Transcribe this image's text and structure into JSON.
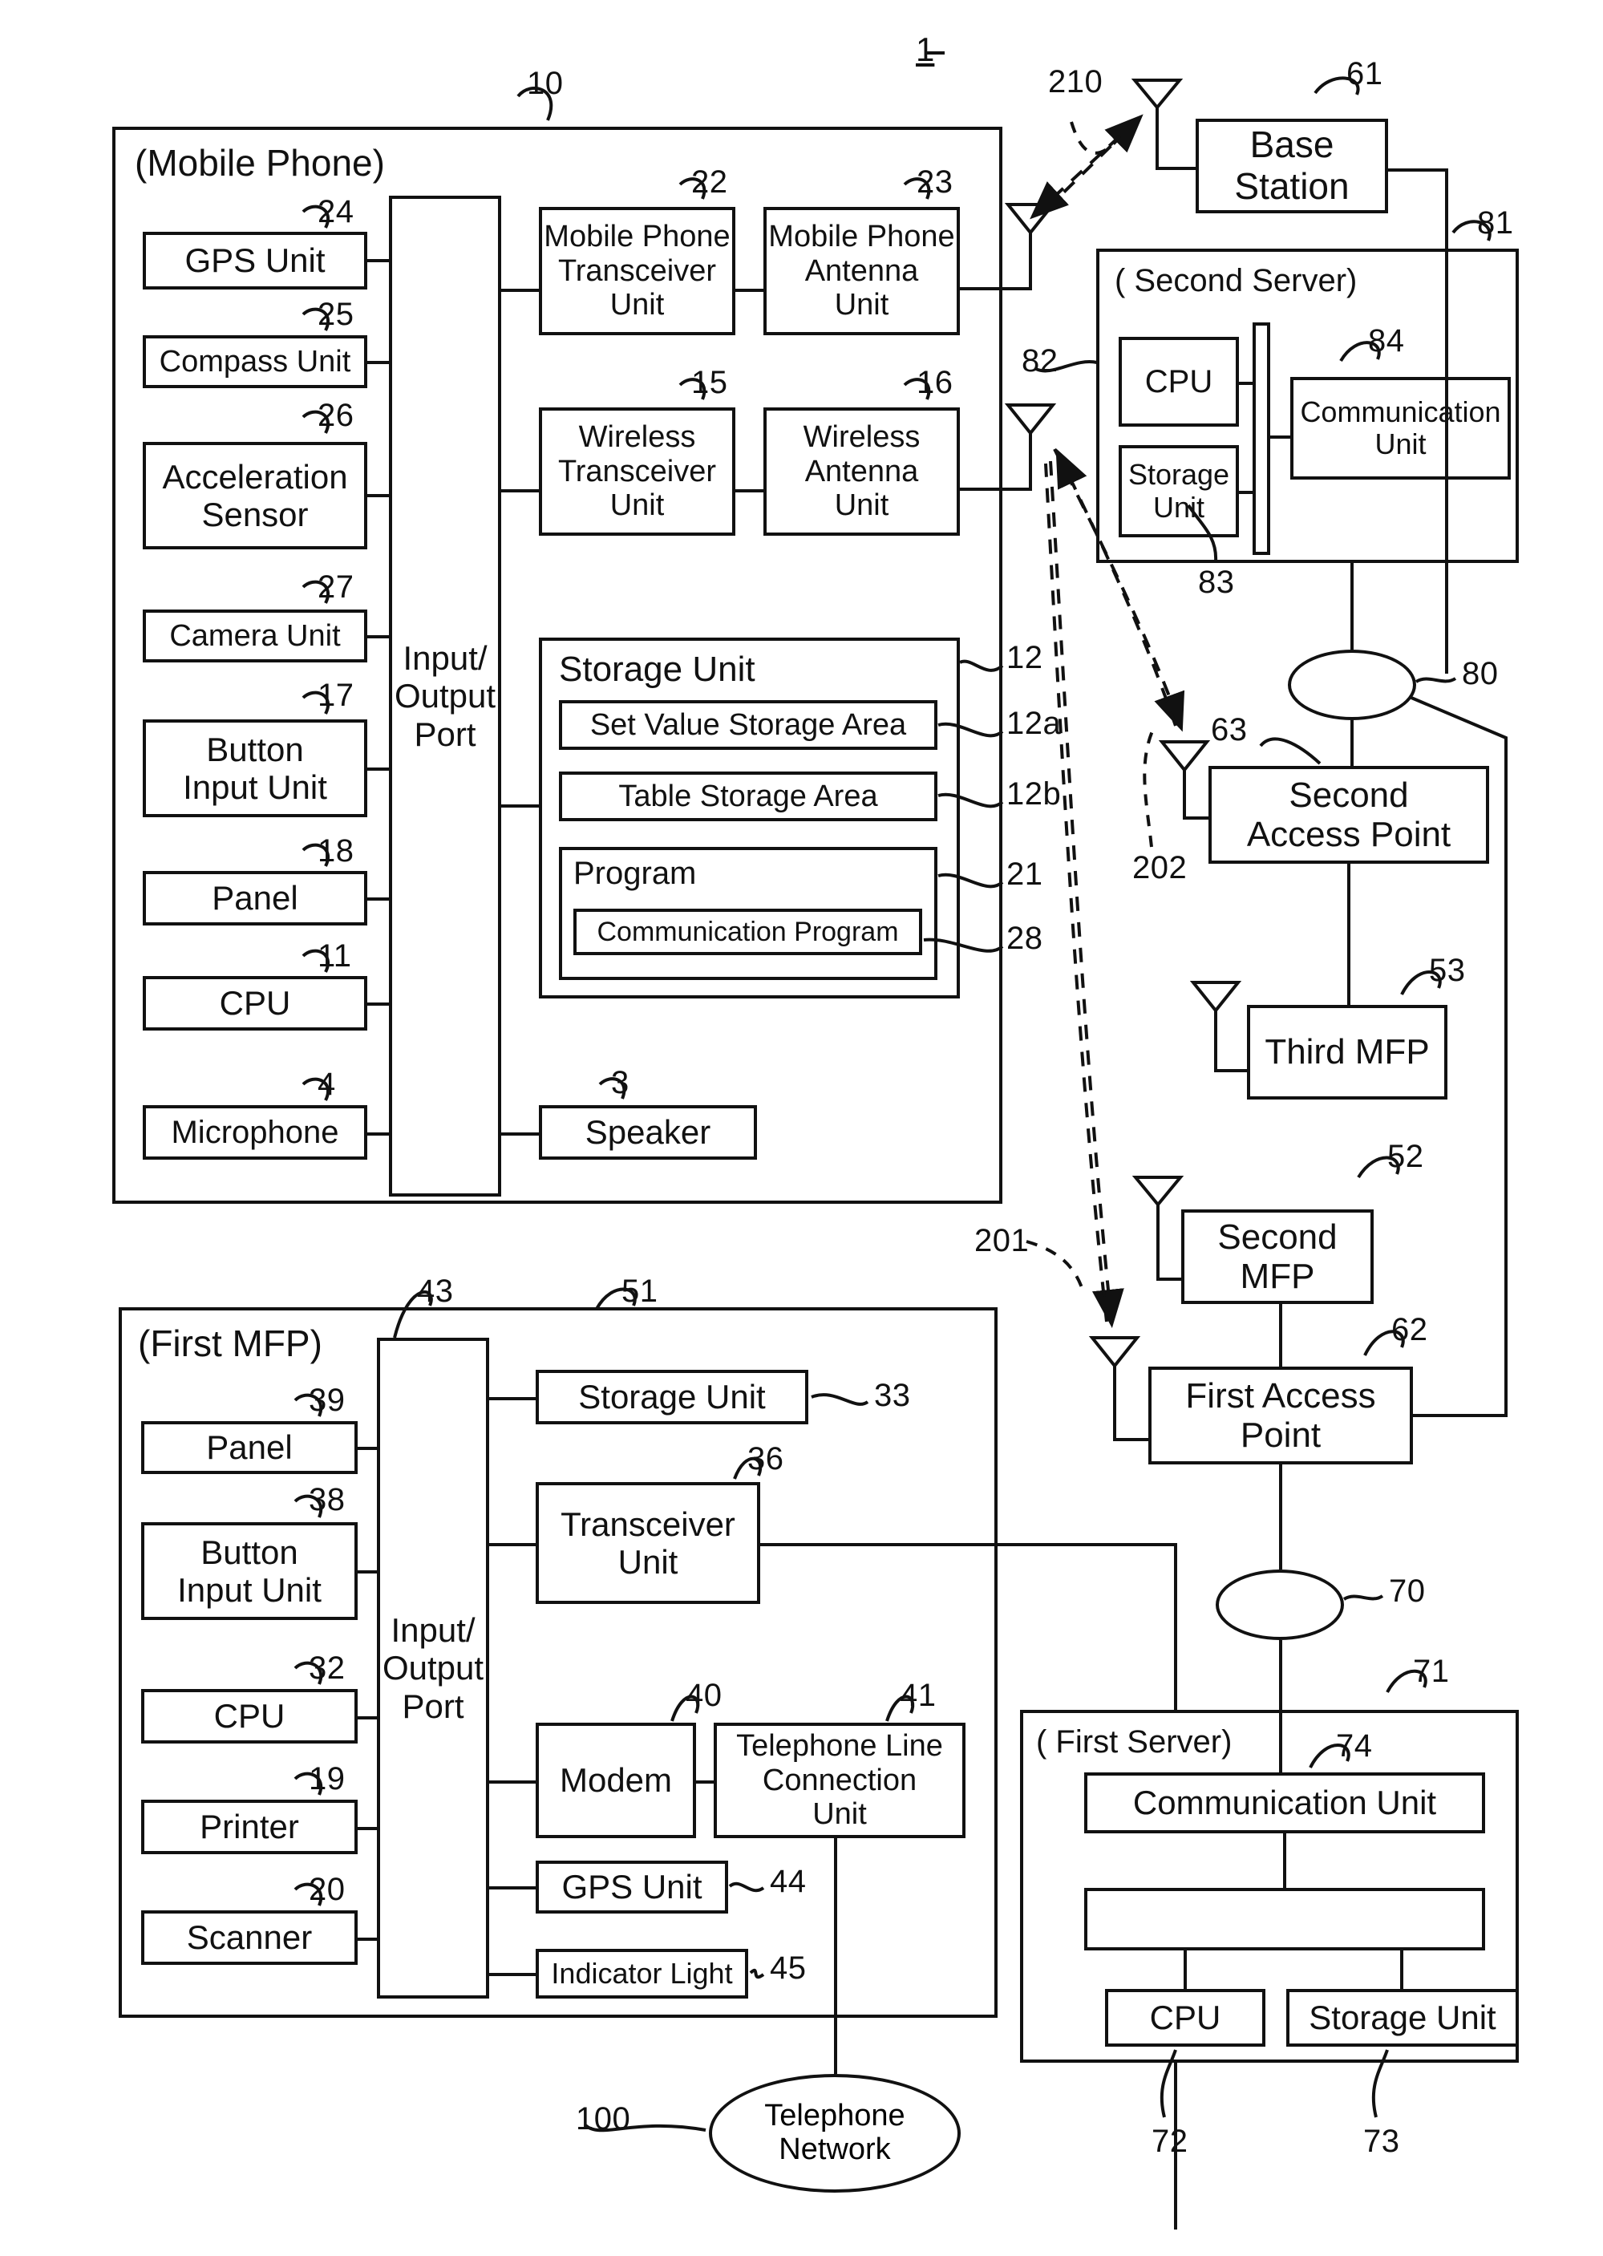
{
  "figure": {
    "number": "1"
  },
  "mobile_phone": {
    "title": "(Mobile Phone)",
    "ref": "10",
    "io_port": {
      "label": "Input/\nOutput\nPort"
    },
    "left_blocks": [
      {
        "label": "GPS Unit",
        "ref": "24"
      },
      {
        "label": "Compass Unit",
        "ref": "25"
      },
      {
        "label": "Acceleration\nSensor",
        "ref": "26"
      },
      {
        "label": "Camera Unit",
        "ref": "27"
      },
      {
        "label": "Button\nInput Unit",
        "ref": "17"
      },
      {
        "label": "Panel",
        "ref": "18"
      },
      {
        "label": "CPU",
        "ref": "11"
      },
      {
        "label": "Microphone",
        "ref": "4"
      }
    ],
    "right_blocks": [
      {
        "label": "Mobile Phone\nTransceiver\nUnit",
        "ref": "22"
      },
      {
        "label": "Mobile Phone\nAntenna\nUnit",
        "ref": "23"
      },
      {
        "label": "Wireless\nTransceiver\nUnit",
        "ref": "15"
      },
      {
        "label": "Wireless\nAntenna\nUnit",
        "ref": "16"
      }
    ],
    "storage": {
      "label": "Storage Unit",
      "ref": "12",
      "areas": [
        {
          "label": "Set Value Storage Area",
          "ref": "12a"
        },
        {
          "label": "Table Storage Area",
          "ref": "12b"
        }
      ],
      "program": {
        "label": "Program",
        "ref": "21",
        "sub": {
          "label": "Communication Program",
          "ref": "28"
        }
      }
    },
    "speaker": {
      "label": "Speaker",
      "ref": "3"
    }
  },
  "first_mfp": {
    "title": "(First MFP)",
    "ref": "51",
    "io_port": {
      "label": "Input/\nOutput\nPort",
      "ref": "43"
    },
    "left_blocks": [
      {
        "label": "Panel",
        "ref": "39"
      },
      {
        "label": "Button\nInput Unit",
        "ref": "38"
      },
      {
        "label": "CPU",
        "ref": "32"
      },
      {
        "label": "Printer",
        "ref": "19"
      },
      {
        "label": "Scanner",
        "ref": "20"
      }
    ],
    "right_blocks": [
      {
        "label": "Storage Unit",
        "ref": "33"
      },
      {
        "label": "Transceiver\nUnit",
        "ref": "36"
      },
      {
        "label": "Modem",
        "ref": "40"
      },
      {
        "label": "Telephone Line\nConnection\nUnit",
        "ref": "41"
      },
      {
        "label": "GPS Unit",
        "ref": "44"
      },
      {
        "label": "Indicator Light",
        "ref": "45"
      }
    ]
  },
  "base_station": {
    "label": "Base\nStation",
    "ref": "61"
  },
  "second_server": {
    "title": "( Second Server)",
    "ref": "81",
    "cpu": {
      "label": "CPU",
      "ref": "82"
    },
    "storage": {
      "label": "Storage\nUnit",
      "ref": "83"
    },
    "communication": {
      "label": "Communication\nUnit",
      "ref": "84"
    }
  },
  "first_server": {
    "title": "( First Server)",
    "ref": "71",
    "communication": {
      "label": "Communication Unit",
      "ref": "74"
    },
    "cpu": {
      "label": "CPU",
      "ref": "72"
    },
    "storage": {
      "label": "Storage Unit",
      "ref": "73"
    }
  },
  "network_nodes": [
    {
      "label": "Second\nAccess Point",
      "ref": "63"
    },
    {
      "label": "Third MFP",
      "ref": "53"
    },
    {
      "label": "Second\nMFP",
      "ref": "52"
    },
    {
      "label": "First Access\nPoint",
      "ref": "62"
    }
  ],
  "clouds": [
    {
      "ref": "80"
    },
    {
      "ref": "70"
    },
    {
      "label": "Telephone\nNetwork",
      "ref": "100"
    }
  ],
  "signal_refs": [
    {
      "ref": "210"
    },
    {
      "ref": "202"
    },
    {
      "ref": "201"
    }
  ]
}
